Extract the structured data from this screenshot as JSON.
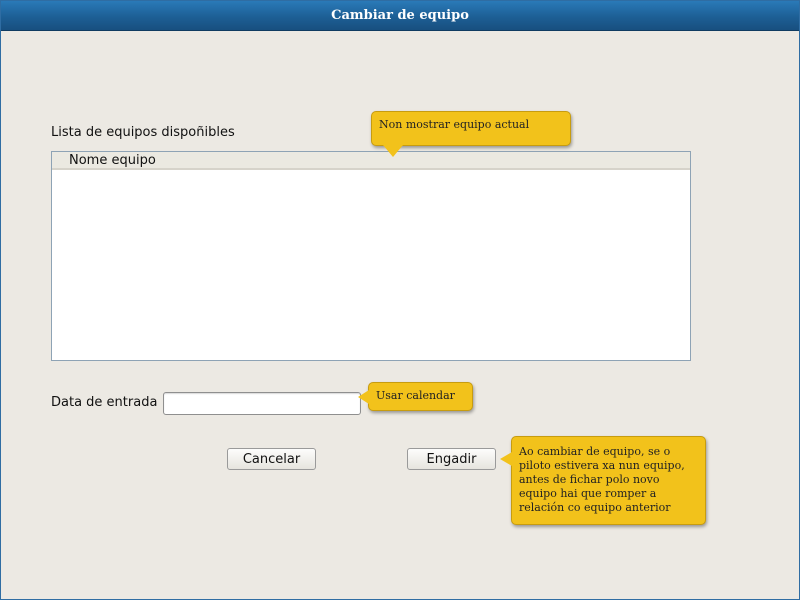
{
  "window": {
    "title": "Cambiar de equipo"
  },
  "list": {
    "label": "Lista de equipos dispoñibles",
    "column_header": "Nome equipo",
    "rows": []
  },
  "date": {
    "label": "Data de entrada",
    "value": "",
    "placeholder": ""
  },
  "buttons": {
    "cancel": "Cancelar",
    "add": "Engadir"
  },
  "notes": {
    "list_note": "Non mostrar equipo actual",
    "date_note": "Usar calendar",
    "add_note": "Ao cambiar de equipo, se o piloto estivera xa nun equipo, antes de fichar polo novo equipo hai que romper a relación co equipo anterior"
  },
  "colors": {
    "titlebar": "#1d5f95",
    "background": "#ece9e3",
    "note": "#f2c21b"
  }
}
